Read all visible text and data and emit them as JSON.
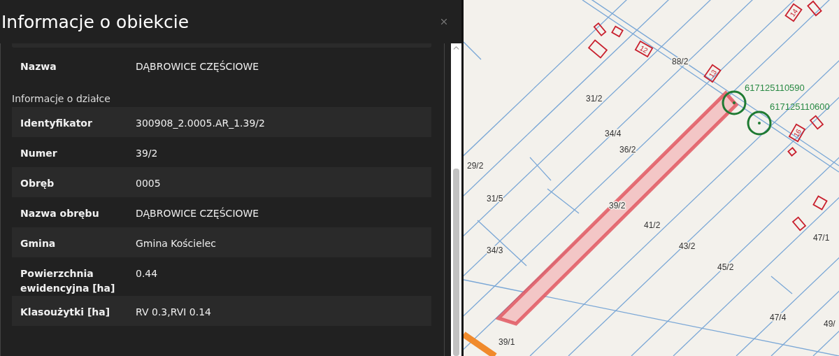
{
  "panel": {
    "title": "Informacje o obiekcie"
  },
  "top_rows": [
    {
      "label": "Nazwa",
      "value": "DĄBROWICE CZĘŚCIOWE"
    }
  ],
  "section": {
    "heading": "Informacje o działce",
    "rows": [
      {
        "label": "Identyfikator",
        "value": "300908_2.0005.AR_1.39/2"
      },
      {
        "label": "Numer",
        "value": "39/2"
      },
      {
        "label": "Obręb",
        "value": "0005"
      },
      {
        "label": "Nazwa obrębu",
        "value": "DĄBROWICE CZĘŚCIOWE"
      },
      {
        "label": "Gmina",
        "value": "Gmina Kościelec"
      },
      {
        "label": "Powierzchnia ewidencyjna [ha]",
        "value": "0.44"
      },
      {
        "label": "Klasoużytki [ha]",
        "value": "RV 0.3,RVI 0.14"
      }
    ]
  },
  "map": {
    "parcels": [
      "88/2",
      "31/2",
      "34/4",
      "36/2",
      "29/2",
      "31/5",
      "39/2",
      "41/2",
      "43/2",
      "45/2",
      "47/1",
      "34/3",
      "47/4",
      "49/",
      "39/1"
    ],
    "points": [
      "617125110590",
      "617125110600"
    ],
    "buildings": [
      "12",
      "13",
      "16",
      "14"
    ]
  }
}
